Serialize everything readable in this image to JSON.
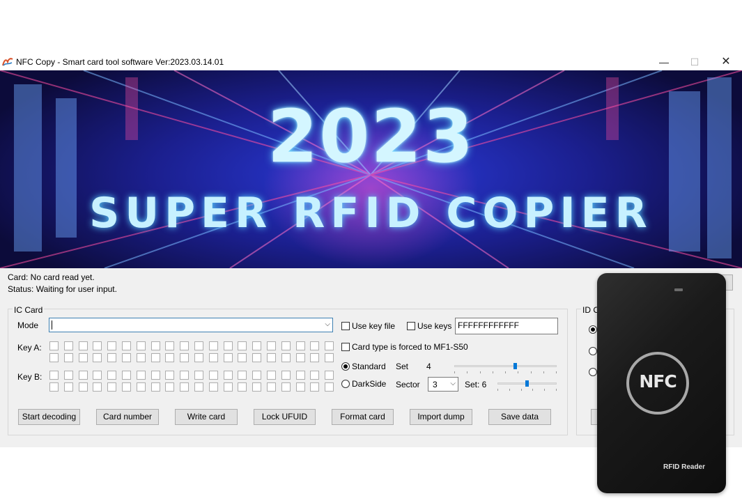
{
  "window": {
    "title": "NFC Copy - Smart card tool software  Ver:2023.03.14.01",
    "controls": {
      "minimize": "—",
      "maximize": "☐",
      "close": "✕"
    }
  },
  "banner": {
    "year": "2023",
    "subtitle": "SUPER RFID COPIER"
  },
  "status": {
    "card": "Card: No card read yet.",
    "status": "Status: Waiting for user input."
  },
  "ic_card": {
    "group_label": "IC Card",
    "mode_label": "Mode",
    "mode_value": "",
    "key_a_label": "Key A:",
    "key_b_label": "Key B:",
    "use_key_file": "Use key file",
    "use_keys": "Use keys",
    "keys_value": "FFFFFFFFFFFF",
    "card_type_forced": "Card type is forced to MF1-S50",
    "standard": "Standard",
    "set_label": "Set",
    "set_value": "4",
    "darkside": "DarkSide",
    "sector_label": "Sector",
    "sector_value": "3",
    "set2_label": "Set: 6",
    "slider1_level": 0.6,
    "slider2_level": 0.5
  },
  "buttons": [
    {
      "label": "Start decoding"
    },
    {
      "label": "Card number"
    },
    {
      "label": "Write card"
    },
    {
      "label": "Lock UFUID"
    },
    {
      "label": "Format card"
    },
    {
      "label": "Import dump"
    },
    {
      "label": "Save data"
    }
  ],
  "id_card": {
    "group_label": "ID C"
  },
  "device": {
    "logo": "NFC",
    "label": "RFID Reader"
  },
  "icons": {
    "app": "app-logo-icon",
    "dropdown": "chevron-down-icon"
  }
}
